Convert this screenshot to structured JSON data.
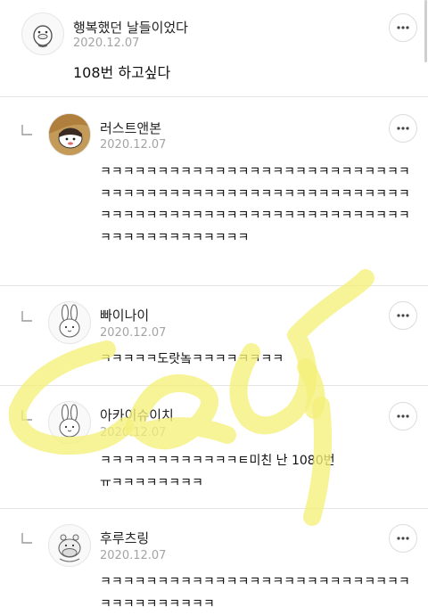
{
  "colors": {
    "date": "#a4a4a4",
    "divider": "#e4e4e4",
    "watermark": "#f5ef7a"
  },
  "comments": [
    {
      "name": "행복했던 날들이었다",
      "date": "2020.12.07",
      "text": "108번 하고싶다",
      "avatar_icon": "duck-avatar-icon",
      "is_reply": false
    },
    {
      "name": "러스트앤본",
      "date": "2020.12.07",
      "text": "ㅋㅋㅋㅋㅋㅋㅋㅋㅋㅋㅋㅋㅋㅋㅋㅋㅋㅋㅋㅋㅋㅋㅋㅋㅋㅋㅋㅋㅋㅋㅋㅋㅋㅋㅋㅋㅋㅋㅋㅋㅋㅋㅋㅋㅋㅋㅋㅋㅋㅋㅋㅋㅋㅋㅋㅋㅋㅋㅋㅋㅋㅋㅋㅋㅋㅋㅋㅋㅋㅋㅋㅋㅋㅋㅋㅋㅋㅋㅋㅋㅋㅋㅋㅋㅋㅋㅋㅋㅋㅋㅋㅋㅋㅋ",
      "avatar_icon": "character-photo-avatar-icon",
      "is_reply": true
    },
    {
      "name": "빠이나이",
      "date": "2020.12.07",
      "text": "ㅋㅋㅋㅋㅋ도랏놐ㅋㅋㅋㅋㅋㅋㅋㅋ",
      "avatar_icon": "rabbit-avatar-icon",
      "is_reply": true
    },
    {
      "name": "아카이슈이치",
      "date": "2020.12.07",
      "text": "ㅋㅋㅋㅋㅋㅋㅋㅋㅋㅋㅋㅋㅌ미친 난 1080번\nㅠㅋㅋㅋㅋㅋㅋㅋㅋ",
      "avatar_icon": "rabbit-avatar-icon",
      "is_reply": true
    },
    {
      "name": "후루츠링",
      "date": "2020.12.07",
      "text": "ㅋㅋㅋㅋㅋㅋㅋㅋㅋㅋㅋㅋㅋㅋㅋㅋㅋㅋㅋㅋㅋㅋㅋㅋㅋㅋㅋㅋㅋㅋㅋㅋㅋㅋㅋㅋㅋ",
      "avatar_icon": "hippo-avatar-icon",
      "is_reply": true
    }
  ],
  "more_icon": "more-dots-icon",
  "reply_icon": "reply-corner-icon"
}
